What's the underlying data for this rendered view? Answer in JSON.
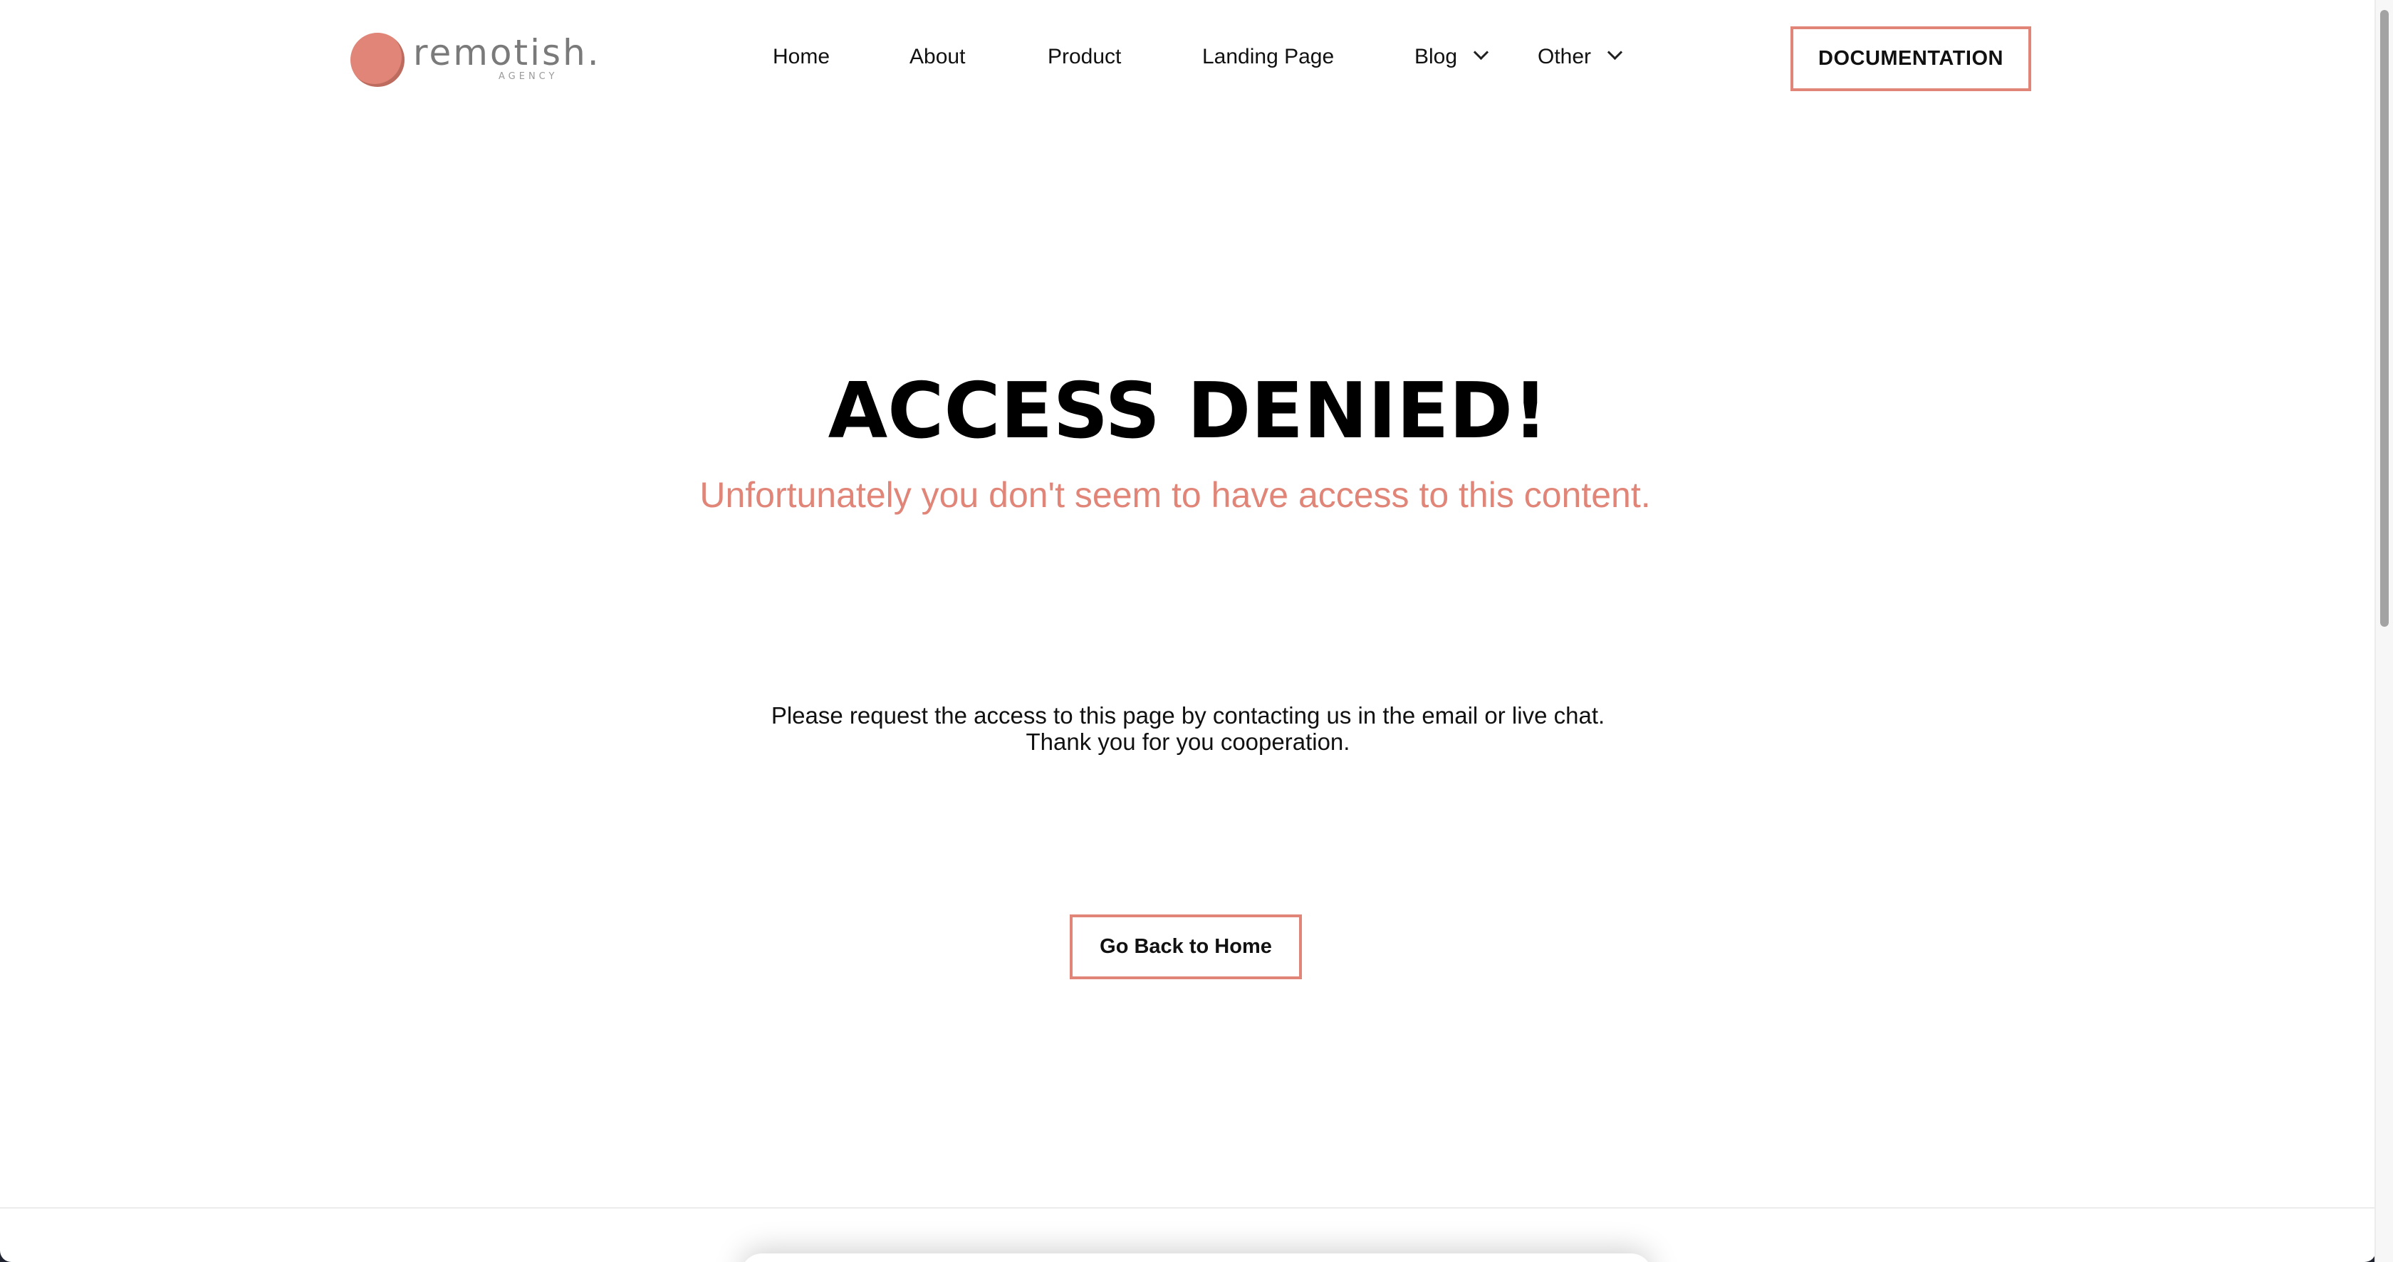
{
  "brand": {
    "name": "remotish.",
    "tagline": "AGENCY",
    "accent_color": "#e08577"
  },
  "nav": {
    "items": [
      {
        "label": "Home"
      },
      {
        "label": "About"
      },
      {
        "label": "Product"
      },
      {
        "label": "Landing Page"
      },
      {
        "label": "Blog",
        "has_dropdown": true
      },
      {
        "label": "Other",
        "has_dropdown": true
      }
    ],
    "cta_label": "DOCUMENTATION"
  },
  "hero": {
    "title": "ACCESS DENIED!",
    "subtitle": "Unfortunately you don't seem to have access to this content."
  },
  "message": {
    "line1": "Please request the access to this page by contacting us in the email or live chat.",
    "line2": "Thank you for you cooperation."
  },
  "actions": {
    "home_label": "Go Back to Home"
  }
}
